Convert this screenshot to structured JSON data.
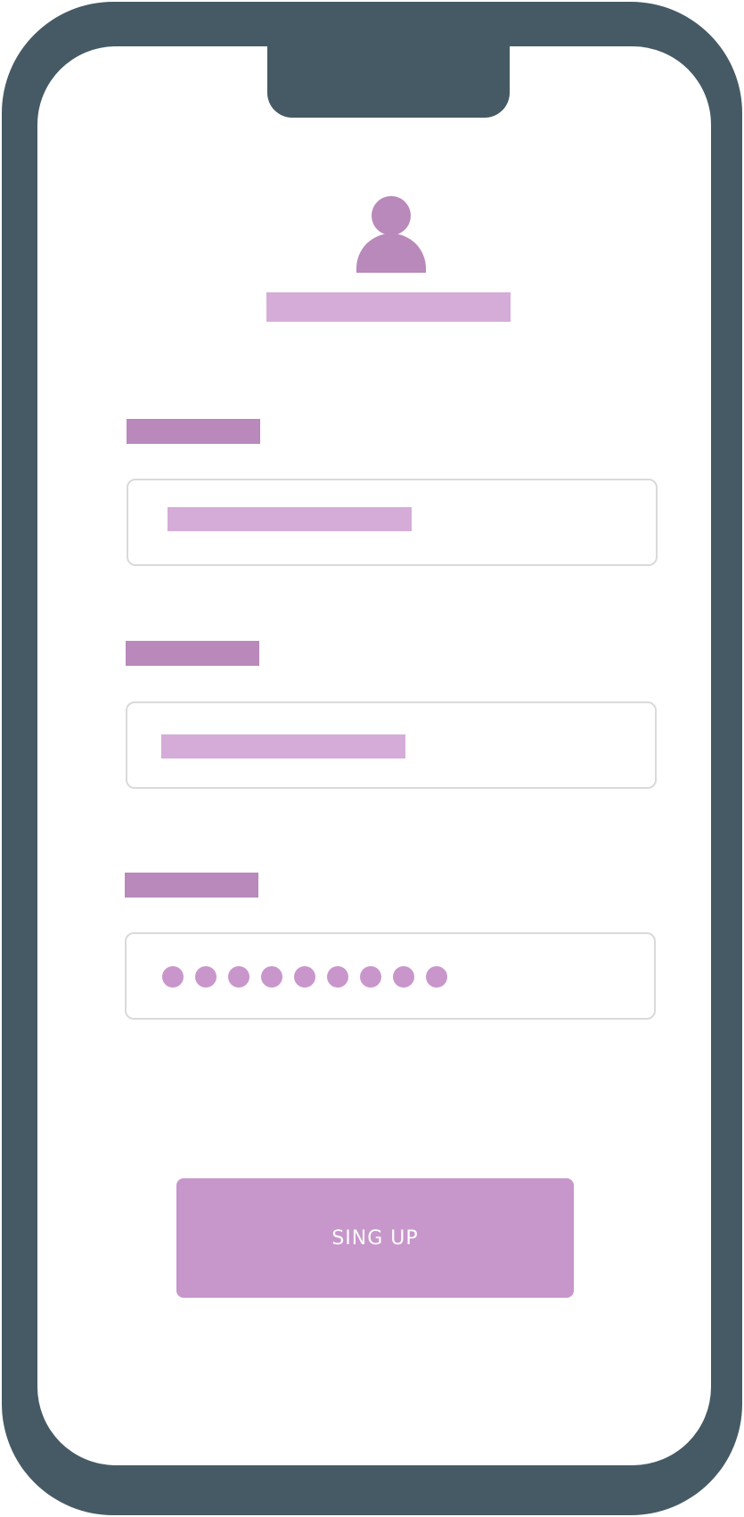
{
  "colors": {
    "frame": "#455a64",
    "accent_dark": "#b889ba",
    "accent_light": "#d5acd8",
    "button": "#c796cb",
    "field_border": "#dadada"
  },
  "header": {
    "avatar_icon": "user-icon"
  },
  "form": {
    "password_dot_count": 9
  },
  "signup_button": {
    "label": "SING UP"
  }
}
